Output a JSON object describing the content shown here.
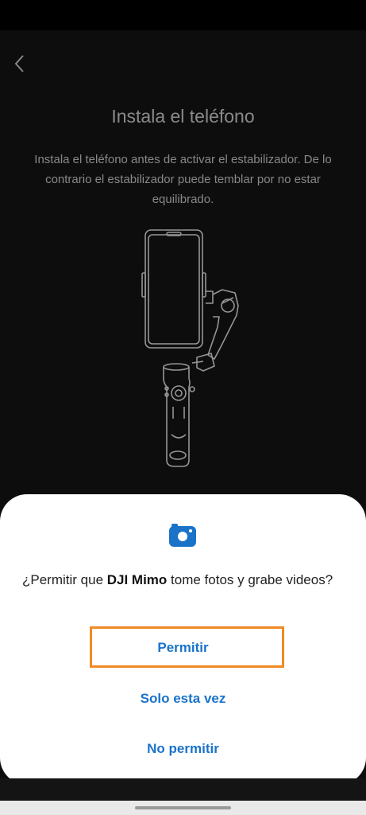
{
  "page": {
    "title": "Instala el teléfono",
    "description": "Instala el teléfono antes de activar el estabilizador. De lo contrario el estabilizador puede temblar por no estar equilibrado."
  },
  "icons": {
    "back": "back-arrow-icon",
    "gimbal": "gimbal-illustration",
    "camera": "camera-icon"
  },
  "dialog": {
    "prefix": "¿Permitir que ",
    "app_name": "DJI Mimo",
    "suffix": " tome fotos y grabe videos?",
    "allow": "Permitir",
    "allow_once": "Solo esta vez",
    "deny": "No permitir"
  },
  "colors": {
    "accent": "#1a73c9",
    "highlight": "#f08a24",
    "background": "#141414"
  }
}
